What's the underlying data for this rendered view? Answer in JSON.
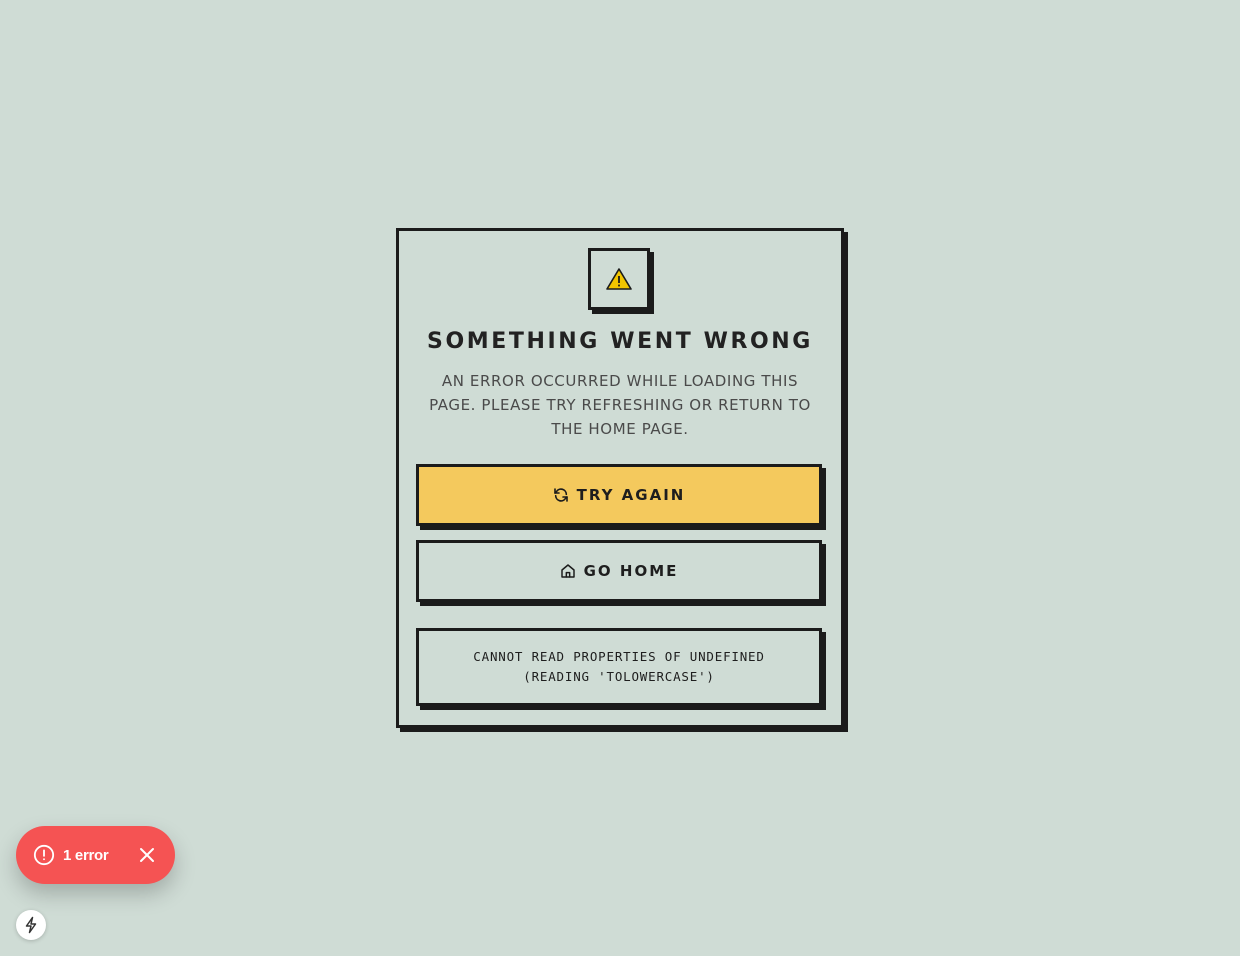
{
  "error_card": {
    "title": "SOMETHING WENT WRONG",
    "description": "AN ERROR OCCURRED WHILE LOADING THIS PAGE. PLEASE TRY REFRESHING OR RETURN TO THE HOME PAGE.",
    "try_again_label": "TRY AGAIN",
    "go_home_label": "GO HOME",
    "error_message": "CANNOT READ PROPERTIES OF UNDEFINED (READING 'TOLOWERCASE')"
  },
  "dev_overlay": {
    "error_count_label": "1 error"
  },
  "icons": {
    "warning": "warning-icon",
    "refresh": "refresh-icon",
    "home": "home-icon",
    "error_alert": "alert-circle-icon",
    "close": "close-icon",
    "nextjs": "lightning-icon"
  },
  "colors": {
    "background": "#cfdcd5",
    "primary_button": "#f4c95d",
    "border": "#1b1b1b",
    "toast": "#f55353"
  }
}
